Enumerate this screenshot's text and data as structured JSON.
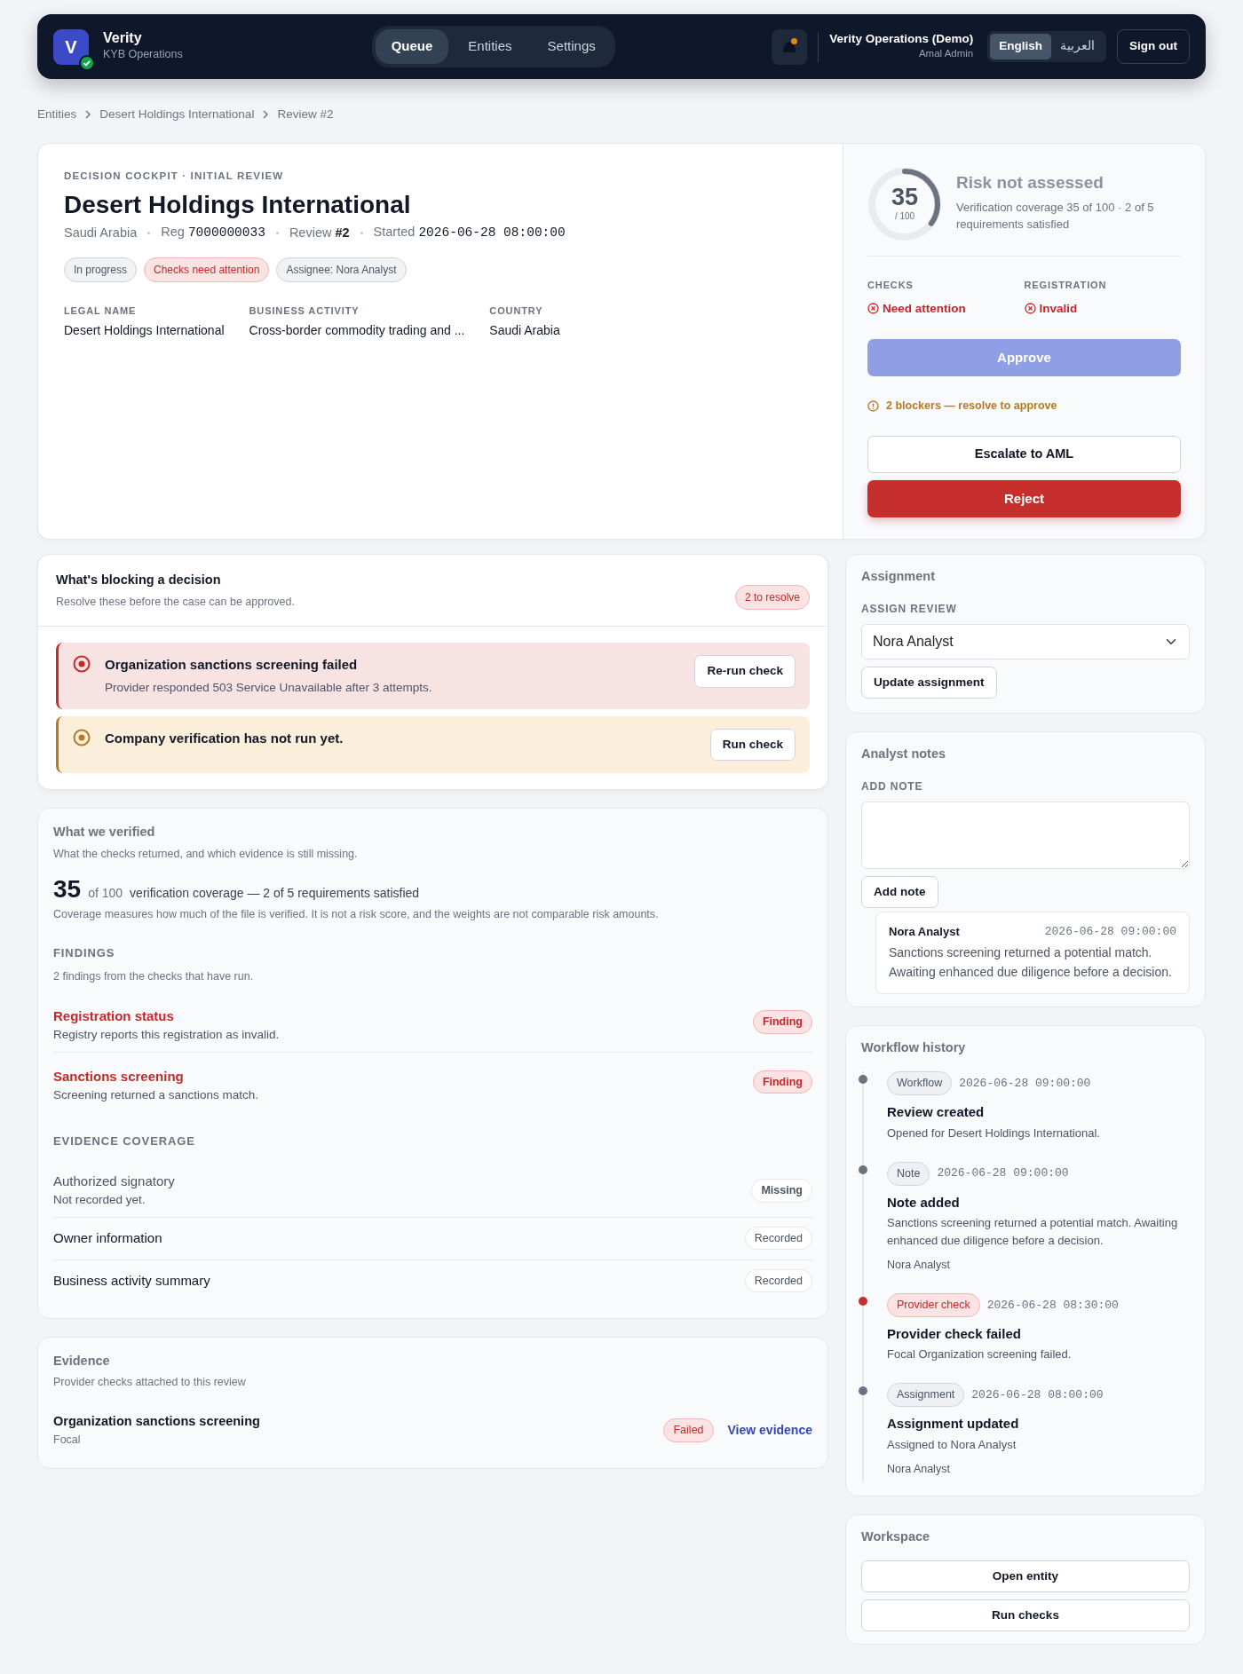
{
  "app": {
    "logo_letter": "V",
    "name": "Verity",
    "subtitle": "KYB Operations",
    "verified": true
  },
  "nav": [
    {
      "label": "Queue",
      "selected": true
    },
    {
      "label": "Entities",
      "selected": false
    },
    {
      "label": "Settings",
      "selected": false
    }
  ],
  "notifications": {
    "unread": true
  },
  "org": {
    "name": "Verity Operations (Demo)",
    "user": "Amal Admin"
  },
  "languages": [
    {
      "label": "English",
      "selected": true
    },
    {
      "label": "العربية",
      "selected": false
    }
  ],
  "sign_out": "Sign out",
  "breadcrumbs": [
    "Entities",
    "Desert Holdings International",
    "Review #2"
  ],
  "header": {
    "eyebrow": "DECISION COCKPIT · INITIAL REVIEW",
    "title": "Desert Holdings International",
    "meta": [
      {
        "kind": "plain",
        "label": "Saudi Arabia"
      },
      {
        "kind": "mono",
        "label": "Reg",
        "value": "7000000033"
      },
      {
        "kind": "bold",
        "label": "Review",
        "value": "#2"
      },
      {
        "kind": "mono",
        "label": "Started",
        "value": "2026-06-28 08:00:00"
      }
    ],
    "badges": [
      {
        "text": "In progress",
        "kind": "neutral"
      },
      {
        "text": "Checks need attention",
        "kind": "danger"
      },
      {
        "text": "Assignee: Nora Analyst",
        "kind": "neutral"
      }
    ],
    "fields": [
      {
        "label": "LEGAL NAME",
        "value": "Desert Holdings International"
      },
      {
        "label": "BUSINESS ACTIVITY",
        "value": "Cross-border commodity trading and ..."
      },
      {
        "label": "COUNTRY",
        "value": "Saudi Arabia"
      }
    ]
  },
  "score": {
    "value": "35",
    "max": "/ 100",
    "level": 0.35,
    "title": "Risk not assessed",
    "text": "Verification coverage 35 of 100 · 2 of 5 requirements satisfied"
  },
  "statuses": [
    {
      "label": "CHECKS",
      "value": "Need attention",
      "kind": "danger"
    },
    {
      "label": "REGISTRATION",
      "value": "Invalid",
      "kind": "danger"
    }
  ],
  "approve": {
    "label": "Approve",
    "disabled": true
  },
  "blocker_note": "2 blockers — resolve to approve",
  "escalate": "Escalate to AML",
  "reject": "Reject",
  "blocking": {
    "title": "What's blocking a decision",
    "subtitle": "Resolve these before the case can be approved.",
    "count": "2 to resolve",
    "items": [
      {
        "kind": "danger",
        "title": "Organization sanctions screening failed",
        "detail": "Provider responded 503 Service Unavailable after 3 attempts.",
        "action": "Re-run check"
      },
      {
        "kind": "warning",
        "title": "Company verification has not run yet.",
        "action": "Run check"
      }
    ]
  },
  "verified": {
    "title": "What we verified",
    "subtitle": "What the checks returned, and which evidence is still missing.",
    "score": "35",
    "score_of": "of 100",
    "score_text": "verification coverage — 2 of 5 requirements satisfied",
    "note": "Coverage measures how much of the file is verified. It is not a risk score, and the weights are not comparable risk amounts.",
    "findings_heading": "FINDINGS",
    "findings_note": "2 findings from the checks that have run.",
    "findings": [
      {
        "title": "Registration status",
        "detail": "Registry reports this registration as invalid.",
        "badge": "Finding"
      },
      {
        "title": "Sanctions screening",
        "detail": "Screening returned a sanctions match.",
        "badge": "Finding"
      }
    ],
    "evidence_heading": "EVIDENCE COVERAGE",
    "evidence": [
      {
        "kind": "missing",
        "title": "Authorized signatory",
        "detail": "Not recorded yet.",
        "badge": "Missing"
      },
      {
        "kind": "recorded",
        "title": "Owner information",
        "badge": "Recorded"
      },
      {
        "kind": "recorded",
        "title": "Business activity summary",
        "badge": "Recorded"
      }
    ]
  },
  "evidence": {
    "title": "Evidence",
    "subtitle": "Provider checks attached to this review",
    "items": [
      {
        "title": "Organization sanctions screening",
        "provider": "Focal",
        "status": "Failed",
        "kind": "danger",
        "link": "View evidence"
      }
    ]
  },
  "assignment": {
    "title": "Assignment",
    "label": "ASSIGN REVIEW",
    "value": "Nora Analyst",
    "button": "Update assignment"
  },
  "notes": {
    "title": "Analyst notes",
    "label": "ADD NOTE",
    "button": "Add note",
    "items": [
      {
        "author": "Nora Analyst",
        "time": "2026-06-28 09:00:00",
        "text": "Sanctions screening returned a potential match. Awaiting enhanced due diligence before a decision."
      }
    ]
  },
  "history": {
    "title": "Workflow history",
    "events": [
      {
        "kind": "neutral",
        "tag": "Workflow",
        "time": "2026-06-28 09:00:00",
        "title": "Review created",
        "detail": "Opened for Desert Holdings International."
      },
      {
        "kind": "neutral",
        "tag": "Note",
        "time": "2026-06-28 09:00:00",
        "title": "Note added",
        "detail": "Sanctions screening returned a potential match. Awaiting enhanced due diligence before a decision.",
        "by": "Nora Analyst"
      },
      {
        "kind": "danger",
        "tag": "Provider check",
        "time": "2026-06-28 08:30:00",
        "title": "Provider check failed",
        "detail": "Focal Organization screening failed."
      },
      {
        "kind": "neutral",
        "tag": "Assignment",
        "time": "2026-06-28 08:00:00",
        "title": "Assignment updated",
        "detail": "Assigned to Nora Analyst",
        "by": "Nora Analyst"
      }
    ]
  },
  "workspace": {
    "title": "Workspace",
    "buttons": [
      "Open entity",
      "Run checks"
    ]
  }
}
